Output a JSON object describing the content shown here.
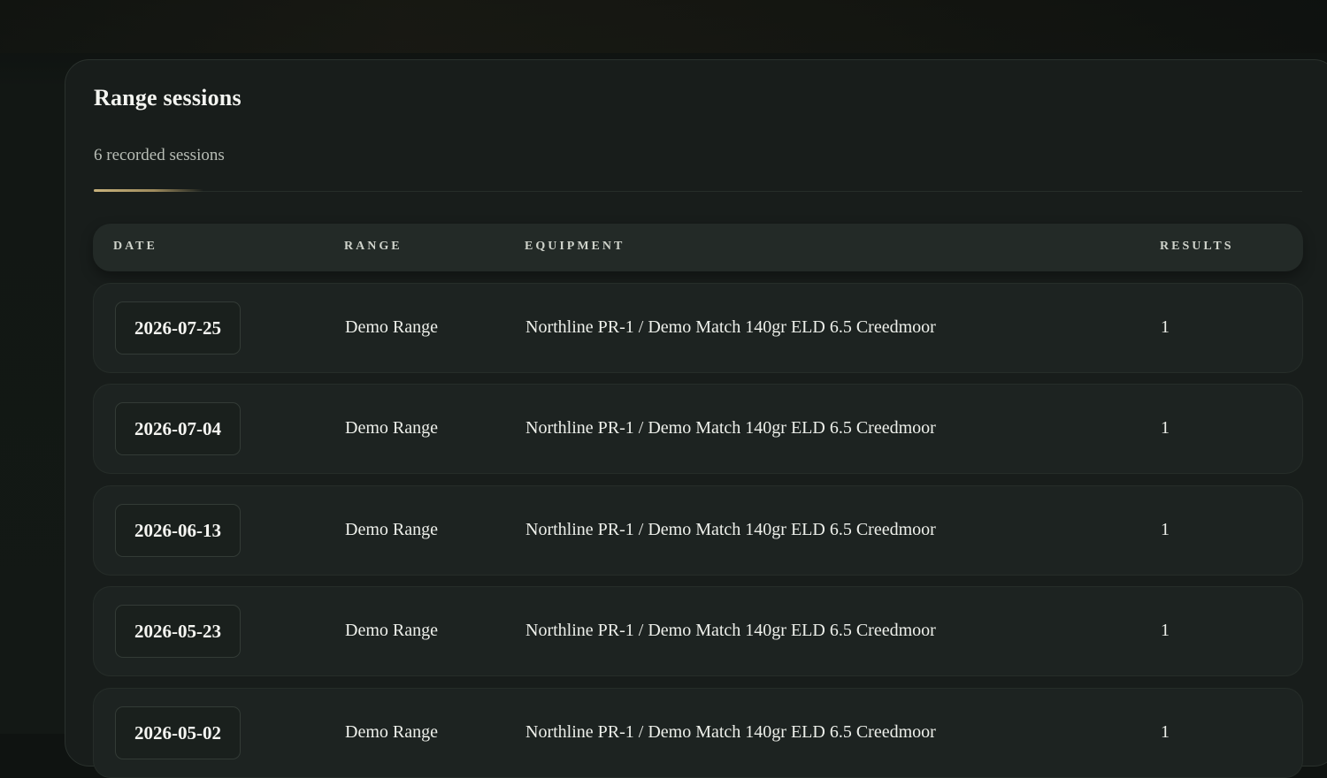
{
  "panel": {
    "title": "Range sessions",
    "subtitle": "6 recorded sessions"
  },
  "table": {
    "columns": {
      "date": "DATE",
      "range": "RANGE",
      "equipment": "EQUIPMENT",
      "results": "RESULTS"
    },
    "rows": [
      {
        "date": "2026-07-25",
        "range": "Demo Range",
        "equipment": "Northline PR-1 / Demo Match 140gr ELD 6.5 Creedmoor",
        "results": "1"
      },
      {
        "date": "2026-07-04",
        "range": "Demo Range",
        "equipment": "Northline PR-1 / Demo Match 140gr ELD 6.5 Creedmoor",
        "results": "1"
      },
      {
        "date": "2026-06-13",
        "range": "Demo Range",
        "equipment": "Northline PR-1 / Demo Match 140gr ELD 6.5 Creedmoor",
        "results": "1"
      },
      {
        "date": "2026-05-23",
        "range": "Demo Range",
        "equipment": "Northline PR-1 / Demo Match 140gr ELD 6.5 Creedmoor",
        "results": "1"
      },
      {
        "date": "2026-05-02",
        "range": "Demo Range",
        "equipment": "Northline PR-1 / Demo Match 140gr ELD 6.5 Creedmoor",
        "results": "1"
      }
    ]
  },
  "colors": {
    "background": "#0f1311",
    "panel": "#181d1b",
    "row": "#1d2321",
    "header": "#232a27",
    "accent": "#c8b27c",
    "text": "#ecefe9"
  }
}
